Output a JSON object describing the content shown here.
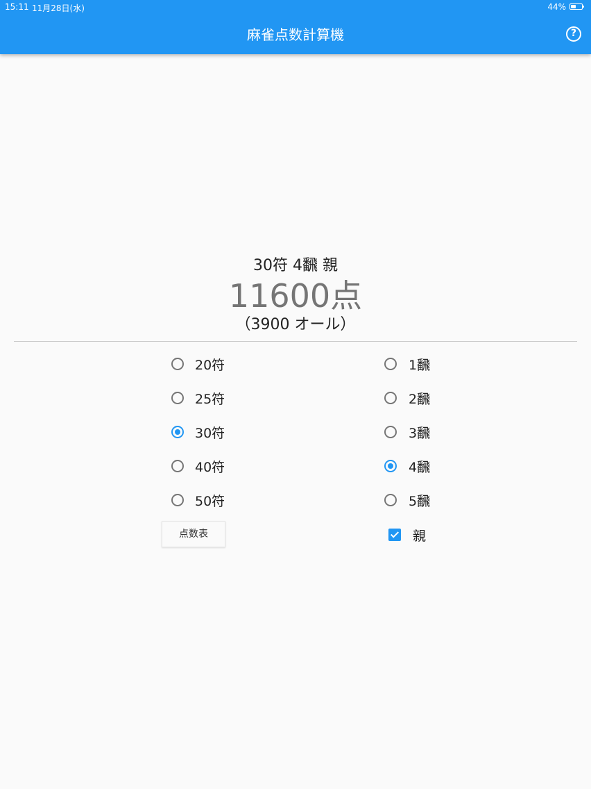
{
  "status_bar": {
    "time": "15:11",
    "date": "11月28日(水)",
    "battery": "44%"
  },
  "app_bar": {
    "title": "麻雀点数計算機",
    "help_icon": "help-circle-icon",
    "help_symbol": "?"
  },
  "result": {
    "summary": "30符 4飜 親",
    "points": "11600点",
    "breakdown": "（3900 オール）"
  },
  "fu_options": [
    {
      "label": "20符",
      "selected": false
    },
    {
      "label": "25符",
      "selected": false
    },
    {
      "label": "30符",
      "selected": true
    },
    {
      "label": "40符",
      "selected": false
    },
    {
      "label": "50符",
      "selected": false
    }
  ],
  "han_options": [
    {
      "label": "1飜",
      "selected": false
    },
    {
      "label": "2飜",
      "selected": false
    },
    {
      "label": "3飜",
      "selected": false
    },
    {
      "label": "4飜",
      "selected": true
    },
    {
      "label": "5飜",
      "selected": false
    }
  ],
  "dealer": {
    "label": "親",
    "checked": true
  },
  "score_table_button": "点数表",
  "colors": {
    "primary": "#2196f3",
    "background": "#fafafa",
    "points_text": "#757575"
  }
}
